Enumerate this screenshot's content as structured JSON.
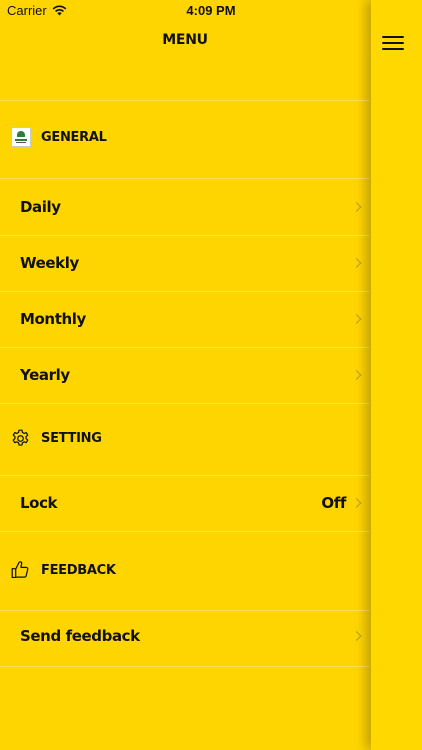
{
  "status_bar": {
    "carrier": "Carrier",
    "time": "4:09 PM"
  },
  "header": {
    "title": "MENU"
  },
  "sections": [
    {
      "title": "GENERAL",
      "icon": "planner-logo-icon",
      "items": [
        {
          "label": "Daily"
        },
        {
          "label": "Weekly"
        },
        {
          "label": "Monthly"
        },
        {
          "label": "Yearly"
        }
      ]
    },
    {
      "title": "SETTING",
      "icon": "gear-icon",
      "items": [
        {
          "label": "Lock",
          "value": "Off"
        }
      ]
    },
    {
      "title": "FEEDBACK",
      "icon": "thumbs-up-icon",
      "items": [
        {
          "label": "Send feedback"
        }
      ]
    }
  ],
  "colors": {
    "background": "#FFD500",
    "panel": "#FFD800",
    "text": "#111111"
  }
}
